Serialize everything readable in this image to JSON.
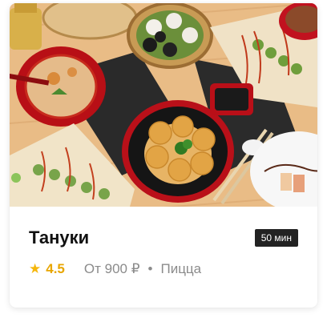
{
  "restaurant": {
    "name": "Тануки",
    "delivery_time": "50 мин",
    "rating": "4.5",
    "price": "От 900 ₽",
    "separator": "•",
    "cuisine": "Пицца"
  },
  "icons": {
    "rating": "star-icon"
  },
  "colors": {
    "rating_star": "#f5b60b",
    "badge_bg": "#222222"
  }
}
